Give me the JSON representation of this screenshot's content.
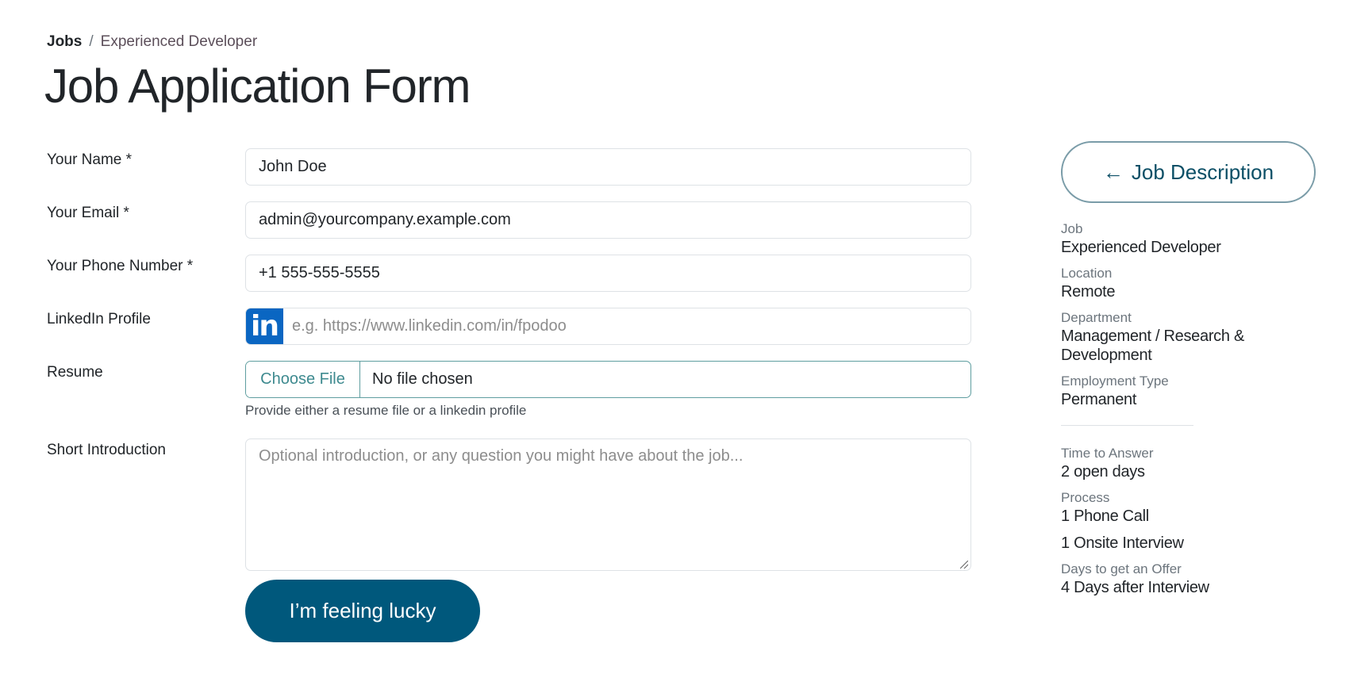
{
  "breadcrumb": {
    "root": "Jobs",
    "separator": "/",
    "current": "Experienced Developer"
  },
  "page_title": "Job Application Form",
  "form": {
    "name": {
      "label": "Your Name *",
      "value": "John Doe"
    },
    "email": {
      "label": "Your Email *",
      "value": "admin@yourcompany.example.com"
    },
    "phone": {
      "label": "Your Phone Number *",
      "value": "+1 555-555-5555"
    },
    "linkedin": {
      "label": "LinkedIn Profile",
      "icon": "in",
      "placeholder": "e.g. https://www.linkedin.com/in/fpodoo"
    },
    "resume": {
      "label": "Resume",
      "button": "Choose File",
      "status": "No file chosen",
      "helper": "Provide either a resume file or a linkedin profile"
    },
    "introduction": {
      "label": "Short Introduction",
      "placeholder": "Optional introduction, or any question you might have about the job..."
    },
    "submit_label": "I’m feeling lucky"
  },
  "sidebar": {
    "job_description_button": {
      "arrow": "🡐",
      "label": "Job Description"
    },
    "details": [
      {
        "label": "Job",
        "values": [
          "Experienced Developer"
        ]
      },
      {
        "label": "Location",
        "values": [
          "Remote"
        ]
      },
      {
        "label": "Department",
        "values": [
          "Management / Research & Development"
        ]
      },
      {
        "label": "Employment Type",
        "values": [
          "Permanent"
        ]
      }
    ],
    "process": [
      {
        "label": "Time to Answer",
        "values": [
          "2 open days"
        ]
      },
      {
        "label": "Process",
        "values": [
          "1 Phone Call",
          "1 Onsite Interview"
        ]
      },
      {
        "label": "Days to get an Offer",
        "values": [
          "4 Days after Interview"
        ]
      }
    ]
  },
  "colors": {
    "primary": "#00587c",
    "linkedin": "#0a66c2",
    "file_border": "#5f9ea0"
  }
}
